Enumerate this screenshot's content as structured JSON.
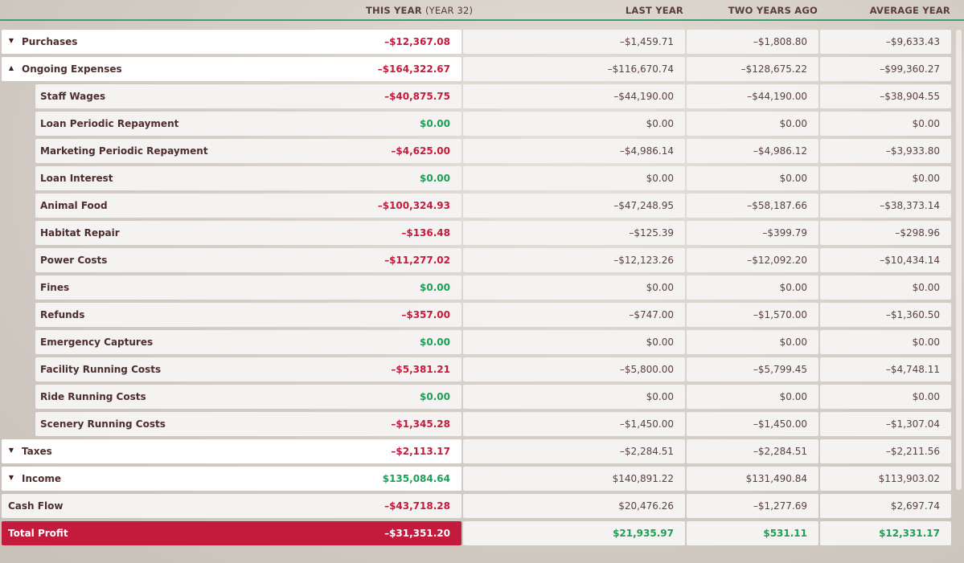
{
  "header": {
    "this_year": "THIS YEAR",
    "this_year_sub": "(YEAR 32)",
    "last_year": "LAST YEAR",
    "two_years_ago": "TWO YEARS AGO",
    "average_year": "AVERAGE YEAR"
  },
  "rows": [
    {
      "label": "Purchases",
      "type": "group",
      "caret": "▼",
      "v": [
        "–$12,367.08",
        "–$1,459.71",
        "–$1,808.80",
        "–$9,633.43"
      ],
      "pos": false
    },
    {
      "label": "Ongoing Expenses",
      "type": "group",
      "caret": "▲",
      "v": [
        "–$164,322.67",
        "–$116,670.74",
        "–$128,675.22",
        "–$99,360.27"
      ],
      "pos": false
    },
    {
      "label": "Staff Wages",
      "type": "sub",
      "v": [
        "–$40,875.75",
        "–$44,190.00",
        "–$44,190.00",
        "–$38,904.55"
      ],
      "pos": false
    },
    {
      "label": "Loan Periodic Repayment",
      "type": "sub",
      "v": [
        "$0.00",
        "$0.00",
        "$0.00",
        "$0.00"
      ],
      "pos": true
    },
    {
      "label": "Marketing Periodic Repayment",
      "type": "sub",
      "v": [
        "–$4,625.00",
        "–$4,986.14",
        "–$4,986.12",
        "–$3,933.80"
      ],
      "pos": false
    },
    {
      "label": "Loan Interest",
      "type": "sub",
      "v": [
        "$0.00",
        "$0.00",
        "$0.00",
        "$0.00"
      ],
      "pos": true
    },
    {
      "label": "Animal Food",
      "type": "sub",
      "v": [
        "–$100,324.93",
        "–$47,248.95",
        "–$58,187.66",
        "–$38,373.14"
      ],
      "pos": false
    },
    {
      "label": "Habitat Repair",
      "type": "sub",
      "v": [
        "–$136.48",
        "–$125.39",
        "–$399.79",
        "–$298.96"
      ],
      "pos": false
    },
    {
      "label": "Power Costs",
      "type": "sub",
      "v": [
        "–$11,277.02",
        "–$12,123.26",
        "–$12,092.20",
        "–$10,434.14"
      ],
      "pos": false
    },
    {
      "label": "Fines",
      "type": "sub",
      "v": [
        "$0.00",
        "$0.00",
        "$0.00",
        "$0.00"
      ],
      "pos": true
    },
    {
      "label": "Refunds",
      "type": "sub",
      "v": [
        "–$357.00",
        "–$747.00",
        "–$1,570.00",
        "–$1,360.50"
      ],
      "pos": false
    },
    {
      "label": "Emergency Captures",
      "type": "sub",
      "v": [
        "$0.00",
        "$0.00",
        "$0.00",
        "$0.00"
      ],
      "pos": true
    },
    {
      "label": "Facility Running Costs",
      "type": "sub",
      "v": [
        "–$5,381.21",
        "–$5,800.00",
        "–$5,799.45",
        "–$4,748.11"
      ],
      "pos": false
    },
    {
      "label": "Ride Running Costs",
      "type": "sub",
      "v": [
        "$0.00",
        "$0.00",
        "$0.00",
        "$0.00"
      ],
      "pos": true
    },
    {
      "label": "Scenery Running Costs",
      "type": "sub",
      "v": [
        "–$1,345.28",
        "–$1,450.00",
        "–$1,450.00",
        "–$1,307.04"
      ],
      "pos": false
    },
    {
      "label": "Taxes",
      "type": "group",
      "caret": "▼",
      "v": [
        "–$2,113.17",
        "–$2,284.51",
        "–$2,284.51",
        "–$2,211.56"
      ],
      "pos": false
    },
    {
      "label": "Income",
      "type": "group",
      "caret": "▼",
      "v": [
        "$135,084.64",
        "$140,891.22",
        "$131,490.84",
        "$113,903.02"
      ],
      "pos": true
    },
    {
      "label": "Cash Flow",
      "type": "cash",
      "v": [
        "–$43,718.28",
        "$20,476.26",
        "–$1,277.69",
        "$2,697.74"
      ],
      "pos": false
    },
    {
      "label": "Total Profit",
      "type": "total",
      "v": [
        "–$31,351.20",
        "$21,935.97",
        "$531.11",
        "$12,331.17"
      ],
      "pos": false
    }
  ],
  "colors": {
    "negative": "#c41a3b",
    "positive": "#1f9e56",
    "total_bg": "#c41a3b"
  },
  "icons": {
    "collapsed": "chevron-down-icon",
    "expanded": "chevron-up-icon"
  }
}
